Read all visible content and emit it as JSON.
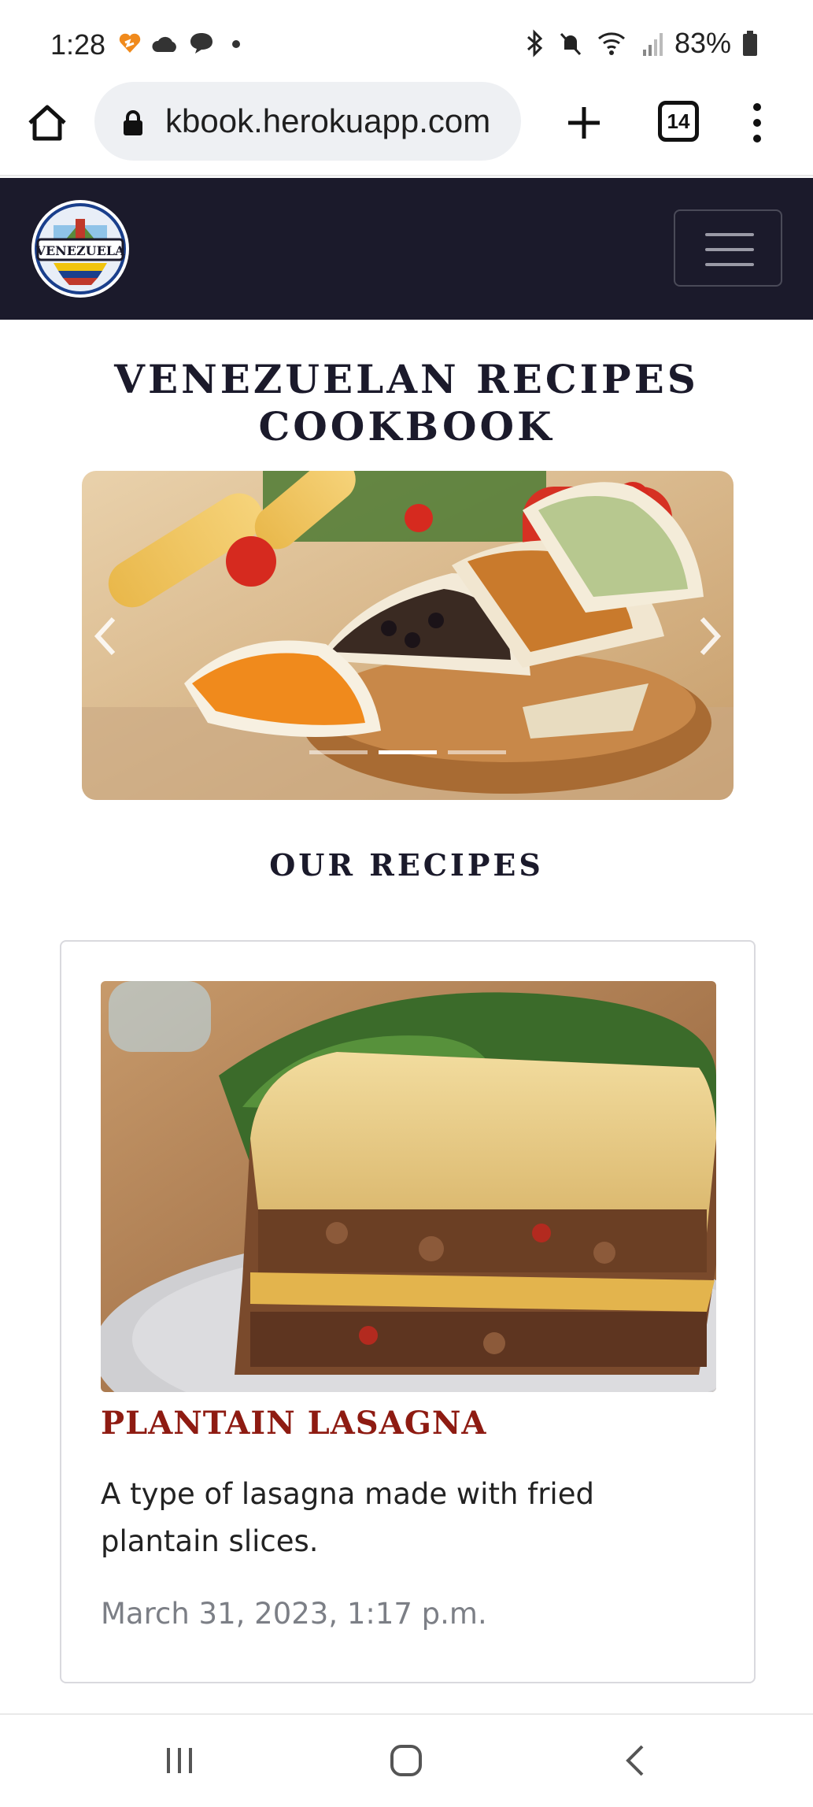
{
  "status_bar": {
    "time": "1:28",
    "battery_percent": "83%",
    "left_icons": [
      "heart-notification-icon",
      "cloud-icon",
      "chat-bubble-icon",
      "dot-icon"
    ],
    "right_icons": [
      "bluetooth-icon",
      "mute-icon",
      "wifi-icon",
      "signal-icon",
      "battery-icon"
    ]
  },
  "browser": {
    "url": "kbook.herokuapp.com",
    "tab_count": "14"
  },
  "site": {
    "title": "VENEZUELAN RECIPES COOKBOOK",
    "logo_text": "VENEZUELA",
    "section_title": "OUR RECIPES",
    "carousel": {
      "slide_count": 3,
      "active_slide": 2
    }
  },
  "recipes": [
    {
      "title": "PLANTAIN LASAGNA",
      "description": "A type of lasagna made with fried plantain slices.",
      "date": "March 31, 2023, 1:17 p.m."
    }
  ],
  "colors": {
    "navbar_bg": "#1b1a2b",
    "recipe_title": "#8e1b12",
    "date_text": "#7c7f86"
  }
}
